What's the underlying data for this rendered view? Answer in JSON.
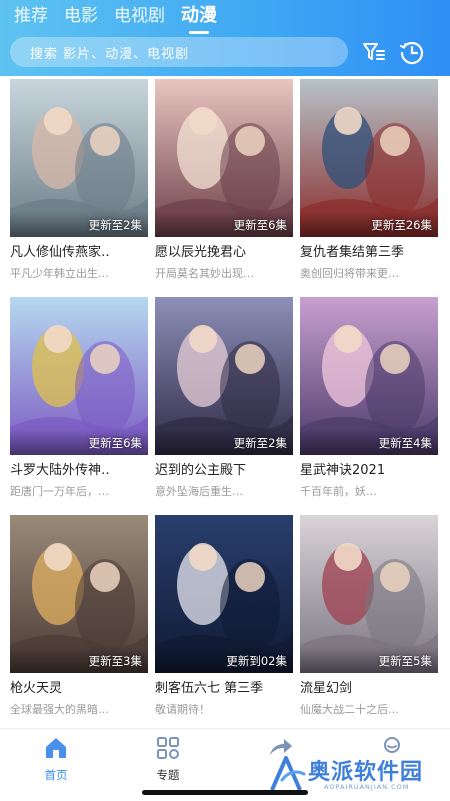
{
  "tabs": [
    "推荐",
    "电影",
    "电视剧",
    "动漫"
  ],
  "active_tab": 3,
  "search": {
    "placeholder": "搜索 影片、动漫、电视剧"
  },
  "header_icons": [
    "filter-icon",
    "history-clock-icon"
  ],
  "cards": [
    {
      "title": "凡人修仙传燕家‥",
      "badge": "更新至2集",
      "desc": "平凡少年韩立出生…",
      "colors": [
        "#c9d6dd",
        "#6b7c86",
        "#d8b8a8"
      ]
    },
    {
      "title": "愿以辰光挽君心",
      "badge": "更新至6集",
      "desc": "开局莫名其妙出现…",
      "colors": [
        "#e9c6c0",
        "#6c3f4a",
        "#f3e2d4"
      ]
    },
    {
      "title": "复仇者集结第三季",
      "badge": "更新至26集",
      "desc": "奥创回归将带来更…",
      "colors": [
        "#b7c3c8",
        "#8a2c2c",
        "#2e4f7a"
      ]
    },
    {
      "title": "斗罗大陆外传神‥",
      "badge": "更新至6集",
      "desc": "距唐门一万年后，…",
      "colors": [
        "#b6d8ef",
        "#7b5ac2",
        "#e0c24a"
      ]
    },
    {
      "title": "迟到的公主殿下",
      "badge": "更新至2集",
      "desc": "意外坠海后重生…",
      "colors": [
        "#8c8fb8",
        "#2f2b45",
        "#e7cfd8"
      ]
    },
    {
      "title": "星武神诀2021",
      "badge": "更新至4集",
      "desc": "千百年前，妖…",
      "colors": [
        "#c7a0cf",
        "#4b3a6a",
        "#f2c8de"
      ]
    },
    {
      "title": "枪火天灵",
      "badge": "更新至3集",
      "desc": "全球最强大的黑暗…",
      "colors": [
        "#9a8a7a",
        "#4a3a35",
        "#e0b060"
      ]
    },
    {
      "title": "刺客伍六七 第三季",
      "badge": "更新到02集",
      "desc": "敬请期待！",
      "colors": [
        "#2a3f6e",
        "#0f1a33",
        "#e8e8f0"
      ]
    },
    {
      "title": "流星幻剑",
      "badge": "更新至5集",
      "desc": "仙魔大战二十之后…",
      "colors": [
        "#d9d4d8",
        "#7a7480",
        "#a04050"
      ]
    }
  ],
  "bottom_nav": [
    {
      "label": "首页",
      "icon": "home-icon",
      "active": true
    },
    {
      "label": "专题",
      "icon": "topics-grid-icon",
      "active": false
    },
    {
      "label": "",
      "icon": "share-icon",
      "active": false
    },
    {
      "label": "",
      "icon": "profile-icon",
      "active": false
    }
  ],
  "watermark": {
    "text": "奥派软件园",
    "sub": "AOPAIRUANJIAN.COM"
  },
  "colors": {
    "accent": "#3a9df3",
    "header_start": "#5ec3f1",
    "header_end": "#2f8ff4",
    "nav_active": "#3a8ff0"
  }
}
